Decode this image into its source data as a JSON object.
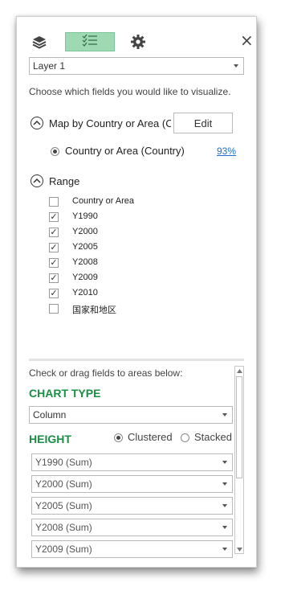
{
  "toolbar": {
    "layers_icon": "layers-icon",
    "fieldlist_icon": "field-list-icon",
    "settings_icon": "gear-icon",
    "close_label": "×",
    "active_color": "#9fd9b4"
  },
  "layer_select": {
    "value": "Layer 1"
  },
  "intro_text": "Choose which fields you would like to visualize.",
  "map_section": {
    "title": "Map by Country or Area (Cc",
    "edit_label": "Edit",
    "option_label": "Country or Area (Country)",
    "confidence": "93%"
  },
  "range_section": {
    "title": "Range",
    "fields": [
      {
        "label": "Country or Area",
        "checked": false
      },
      {
        "label": "Y1990",
        "checked": true
      },
      {
        "label": "Y2000",
        "checked": true
      },
      {
        "label": "Y2005",
        "checked": true
      },
      {
        "label": "Y2008",
        "checked": true
      },
      {
        "label": "Y2009",
        "checked": true
      },
      {
        "label": "Y2010",
        "checked": true
      },
      {
        "label": "国家和地区",
        "checked": false
      }
    ]
  },
  "areas": {
    "instruction": "Check or drag fields to areas below:",
    "chart_type_heading": "CHART TYPE",
    "chart_type_value": "Column",
    "height_heading": "HEIGHT",
    "clustered_label": "Clustered",
    "stacked_label": "Stacked",
    "height_fields": [
      "Y1990 (Sum)",
      "Y2000 (Sum)",
      "Y2005 (Sum)",
      "Y2008 (Sum)",
      "Y2009 (Sum)"
    ],
    "heading_color": "#1a8f43"
  }
}
